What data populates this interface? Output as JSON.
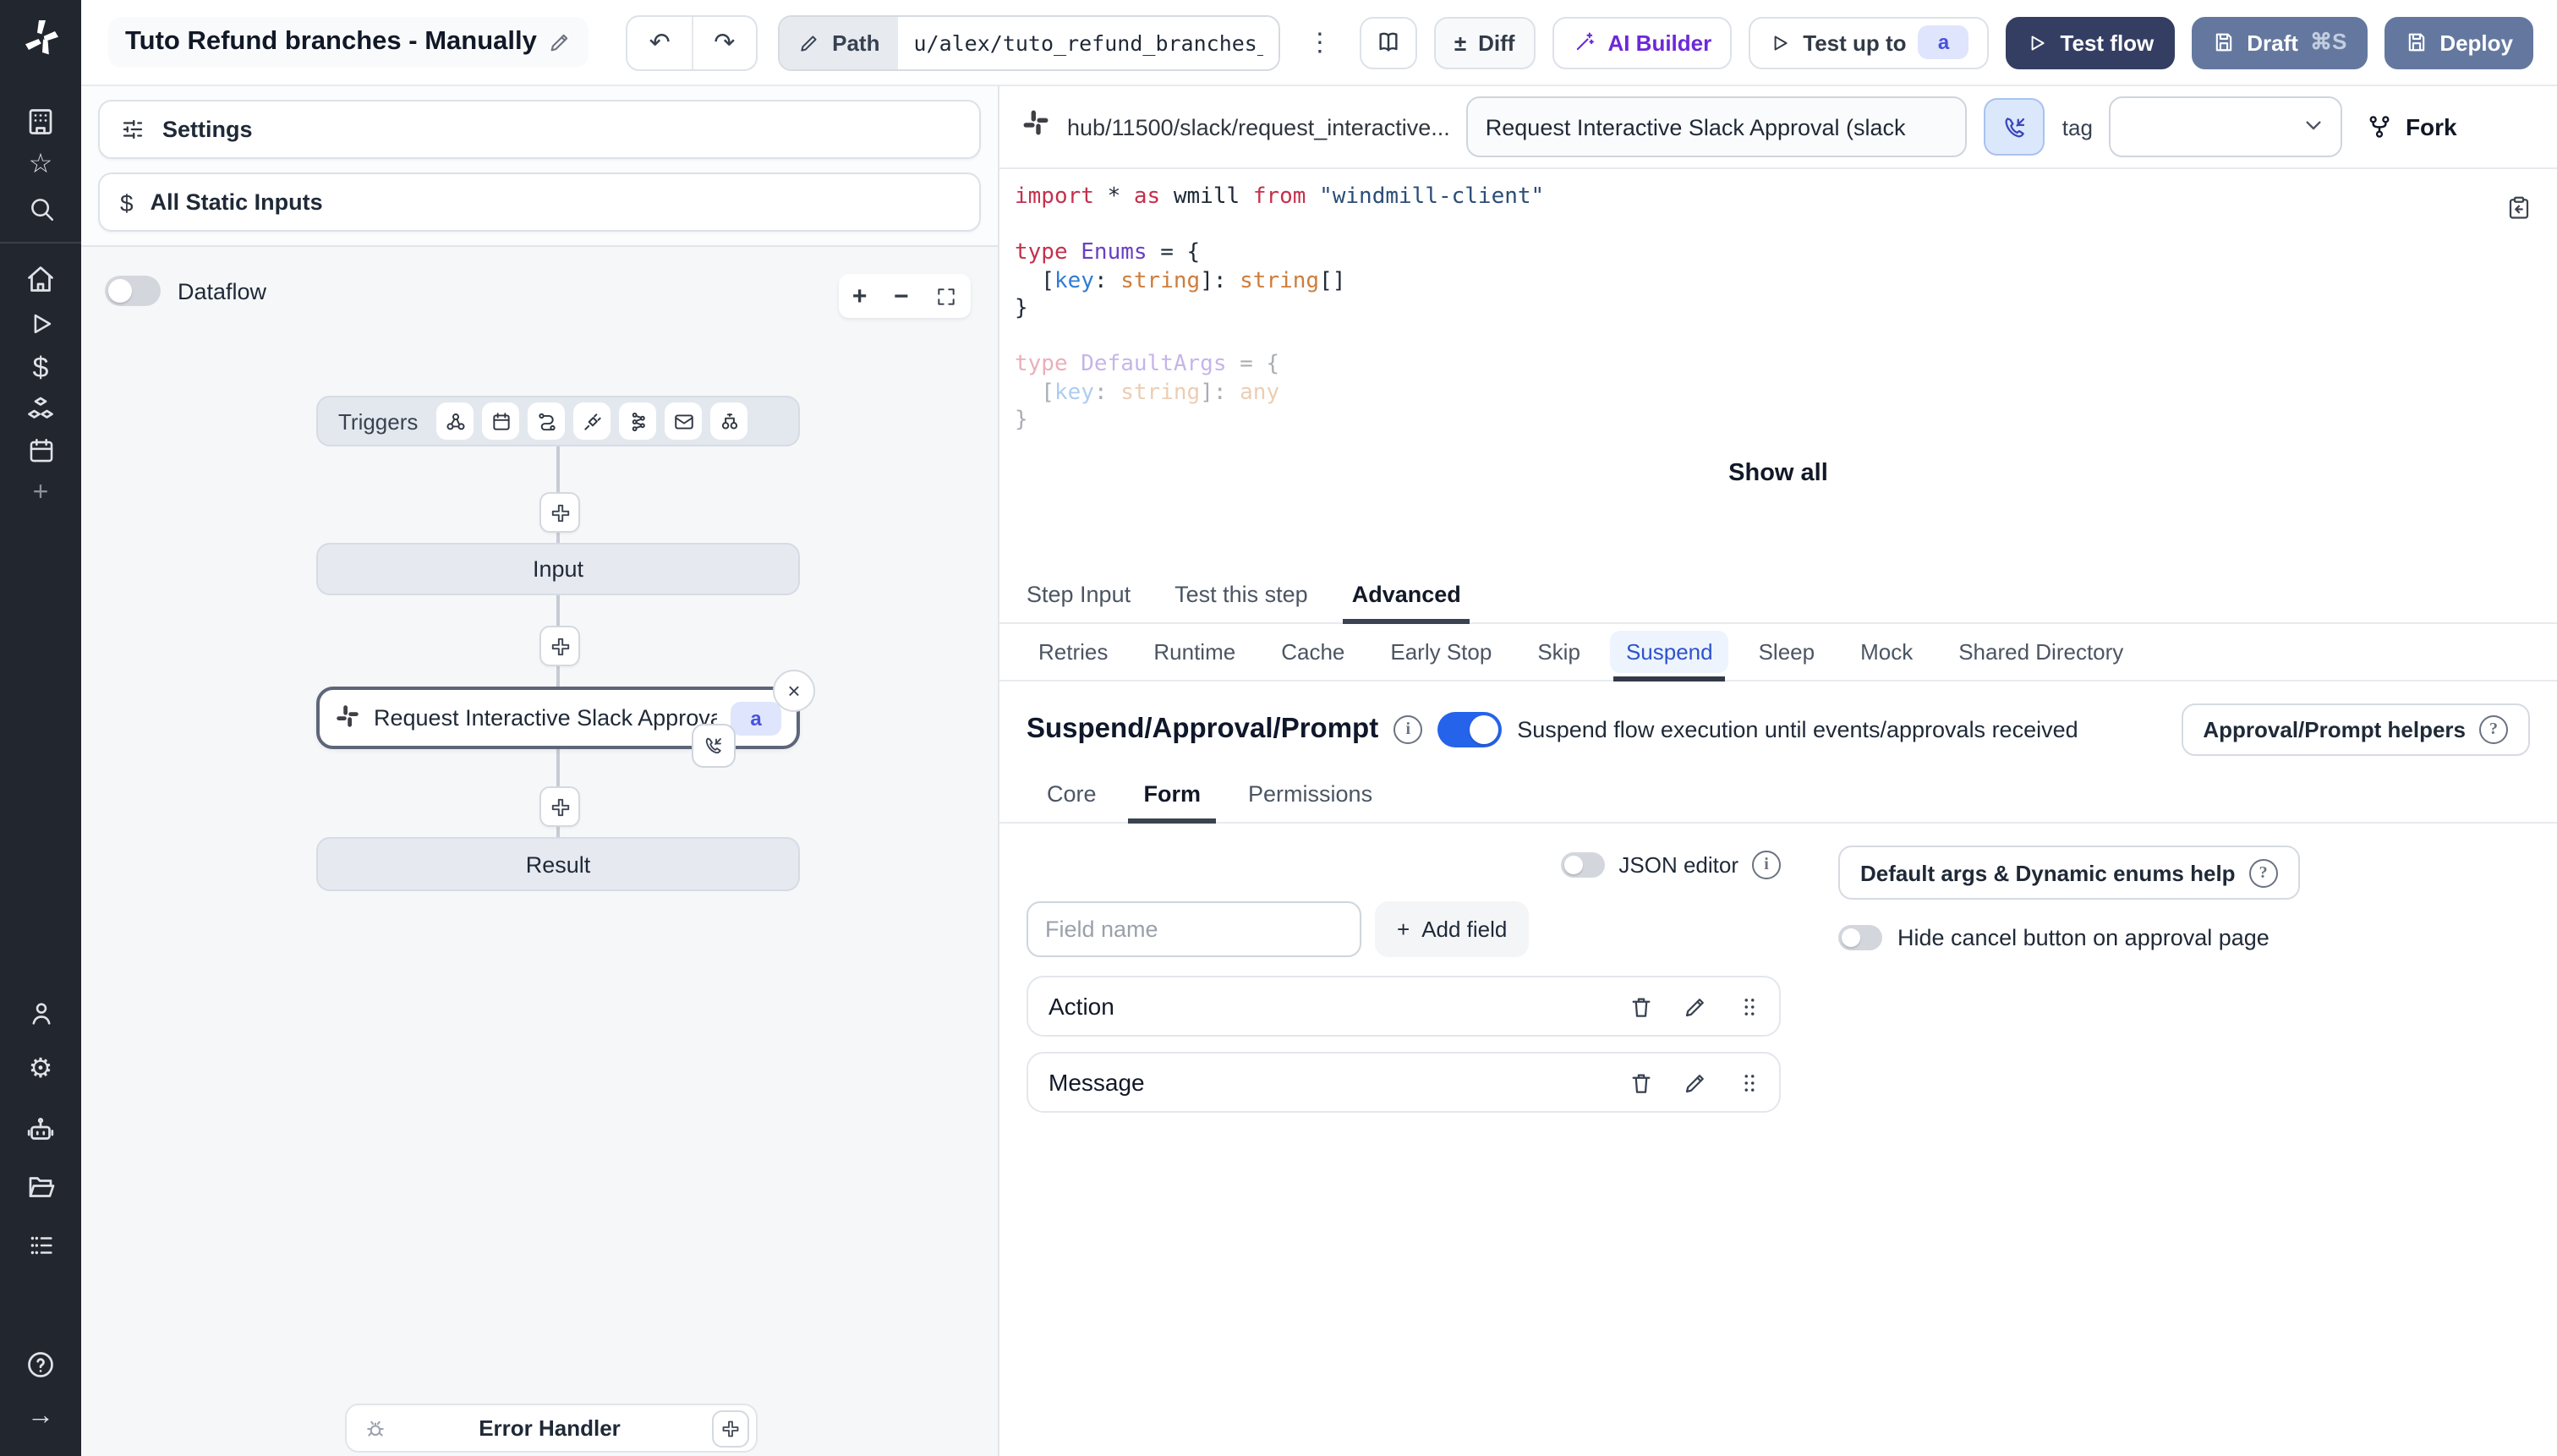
{
  "topbar": {
    "title": "Tuto Refund branches - Manually",
    "path_label": "Path",
    "path_value": "u/alex/tuto_refund_branches_",
    "diff": "Diff",
    "ai_builder": "AI Builder",
    "test_up_to": "Test up to",
    "test_badge": "a",
    "test_flow": "Test flow",
    "draft": "Draft",
    "draft_shortcut": "⌘S",
    "deploy": "Deploy"
  },
  "left": {
    "settings": "Settings",
    "static_inputs": "All Static Inputs",
    "dataflow": "Dataflow",
    "triggers": "Triggers",
    "input": "Input",
    "step_label": "Request Interactive Slack Approval (...",
    "step_badge": "a",
    "result": "Result",
    "error_handler": "Error Handler"
  },
  "right": {
    "script_path": "hub/11500/slack/request_interactive...",
    "script_name": "Request Interactive Slack Approval (slack",
    "tag": "tag",
    "fork": "Fork",
    "show_all": "Show all",
    "tabs": [
      "Step Input",
      "Test this step",
      "Advanced"
    ],
    "subtabs": [
      "Retries",
      "Runtime",
      "Cache",
      "Early Stop",
      "Skip",
      "Suspend",
      "Sleep",
      "Mock",
      "Shared Directory"
    ],
    "code": {
      "l1": [
        "import",
        " * ",
        "as",
        " wmill ",
        "from",
        " \"windmill-client\""
      ],
      "l2": [
        "type",
        " ",
        "Enums",
        " = {"
      ],
      "l3": [
        "  [",
        "key",
        ": ",
        "string",
        "]: ",
        "string",
        "[]"
      ],
      "l4": [
        "}"
      ],
      "l5": [
        "type",
        " ",
        "DefaultArgs",
        " = {"
      ],
      "l6": [
        "  [",
        "key",
        ": ",
        "string",
        "]: ",
        "any"
      ],
      "l7": [
        "}"
      ]
    },
    "suspend": {
      "heading": "Suspend/Approval/Prompt",
      "toggle_text": "Suspend flow execution until events/approvals received",
      "helpers": "Approval/Prompt helpers",
      "tabs": [
        "Core",
        "Form",
        "Permissions"
      ],
      "json_editor": "JSON editor",
      "field_placeholder": "Field name",
      "add_field": "Add field",
      "fields": [
        "Action",
        "Message"
      ],
      "default_args_help": "Default args & Dynamic enums help",
      "hide_cancel": "Hide cancel button on approval page"
    }
  },
  "glyphs": {
    "undo": "↶",
    "redo": "↷",
    "kebab": "⋮",
    "diff": "±",
    "close": "×",
    "dollar": "$",
    "plus": "+",
    "arrow_right": "→",
    "gear": "⚙",
    "star": "☆",
    "add": "+",
    "minus": "−",
    "question": "?",
    "info": "i"
  },
  "colors": {
    "accent_blue": "#2563eb",
    "dark_button": "#343e63",
    "slate_button": "#64789f",
    "ai_purple": "#6d28d9",
    "badge_bg": "#dfe5fc",
    "badge_text": "#4652e0",
    "active_subtab": "#2d53cc",
    "sidebar_bg": "#22262e"
  }
}
